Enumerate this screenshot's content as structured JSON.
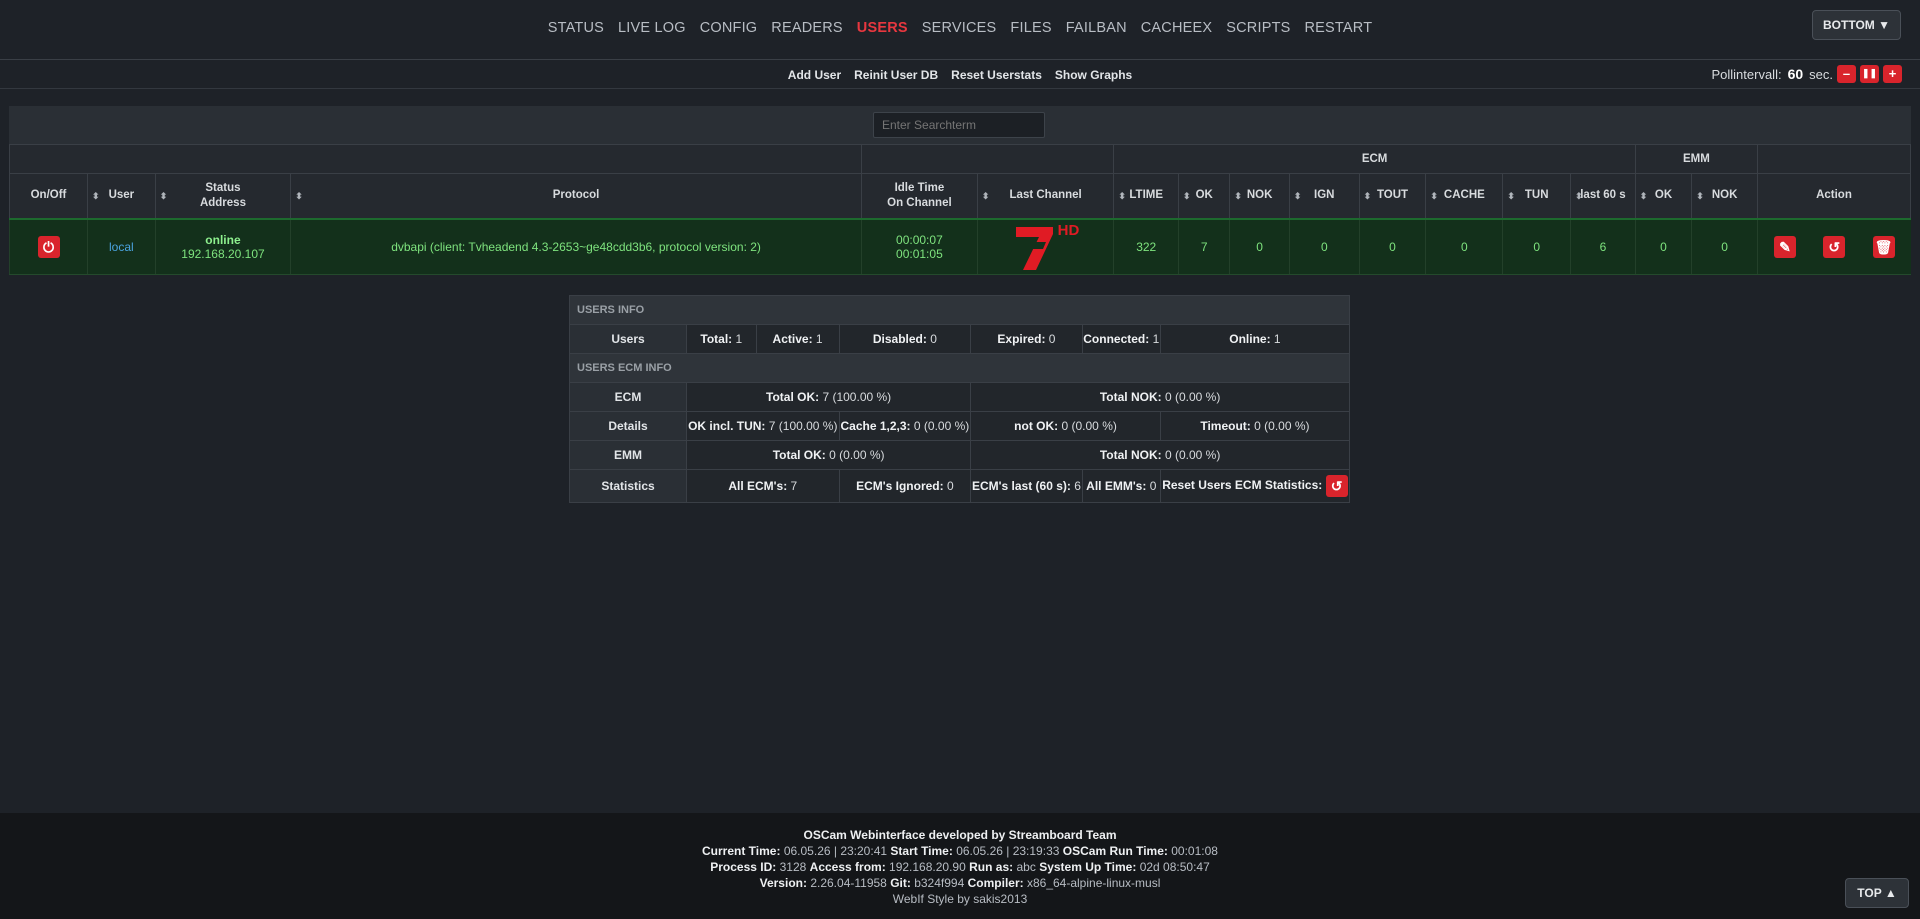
{
  "nav": {
    "items": [
      "STATUS",
      "LIVE LOG",
      "CONFIG",
      "READERS",
      "USERS",
      "SERVICES",
      "FILES",
      "FAILBAN",
      "CACHEEX",
      "SCRIPTS",
      "RESTART"
    ],
    "active": "USERS",
    "bottom_button": "BOTTOM ▼"
  },
  "subnav": {
    "items": [
      "Add User",
      "Reinit User DB",
      "Reset Userstats",
      "Show Graphs"
    ],
    "poll_label": "Pollintervall:",
    "poll_value": "60",
    "poll_unit": "sec.",
    "minus": "–",
    "pause": "❚❚",
    "plus": "+"
  },
  "search": {
    "placeholder": "Enter Searchterm"
  },
  "table": {
    "group_ecm": "ECM",
    "group_emm": "EMM",
    "headers": {
      "onoff": "On/Off",
      "user": "User",
      "status": "Status",
      "address": "Address",
      "protocol": "Protocol",
      "idle": "Idle Time",
      "onchannel": "On Channel",
      "lastchannel": "Last Channel",
      "ltime": "LTIME",
      "ok": "OK",
      "nok": "NOK",
      "ign": "IGN",
      "tout": "TOUT",
      "cache": "CACHE",
      "tun": "TUN",
      "last60": "last 60 s",
      "emm_ok": "OK",
      "emm_nok": "NOK",
      "action": "Action"
    },
    "row": {
      "user": "local",
      "status": "online",
      "address": "192.168.20.107",
      "protocol": "dvbapi (client: Tvheadend 4.3-2653~ge48cdd3b6, protocol version: 2)",
      "idle": "00:00:07",
      "onchannel": "00:01:05",
      "channel_logo_text": "HD",
      "ltime": "322",
      "ok": "7",
      "nok": "0",
      "ign": "0",
      "tout": "0",
      "cache": "0",
      "tun": "0",
      "last60": "6",
      "emm_ok": "0",
      "emm_nok": "0"
    }
  },
  "users_info": {
    "title": "USERS INFO",
    "users_label": "Users",
    "total_l": "Total:",
    "total_v": "1",
    "active_l": "Active:",
    "active_v": "1",
    "disabled_l": "Disabled:",
    "disabled_v": "0",
    "expired_l": "Expired:",
    "expired_v": "0",
    "connected_l": "Connected:",
    "connected_v": "1",
    "online_l": "Online:",
    "online_v": "1"
  },
  "ecm_info": {
    "title": "USERS ECM INFO",
    "ecm_label": "ECM",
    "ecm_ok_l": "Total OK:",
    "ecm_ok_v": "7 (100.00 %)",
    "ecm_nok_l": "Total NOK:",
    "ecm_nok_v": "0 (0.00 %)",
    "details_label": "Details",
    "okincl_l": "OK incl. TUN:",
    "okincl_v": "7 (100.00 %)",
    "cache_l": "Cache 1,2,3:",
    "cache_v": "0 (0.00 %)",
    "notok_l": "not OK:",
    "notok_v": "0 (0.00 %)",
    "timeout_l": "Timeout:",
    "timeout_v": "0 (0.00 %)",
    "emm_label": "EMM",
    "emm_ok_l": "Total OK:",
    "emm_ok_v": "0 (0.00 %)",
    "emm_nok_l": "Total NOK:",
    "emm_nok_v": "0 (0.00 %)",
    "stats_label": "Statistics",
    "allecm_l": "All ECM's:",
    "allecm_v": "7",
    "ignored_l": "ECM's Ignored:",
    "ignored_v": "0",
    "last60_l": "ECM's last (60 s):",
    "last60_v": "6",
    "allemm_l": "All EMM's:",
    "allemm_v": "0",
    "reset_l": "Reset Users ECM Statistics:"
  },
  "footer": {
    "line1": "OSCam Webinterface developed by Streamboard Team",
    "current_time_l": "Current Time:",
    "current_time_v": "06.05.26 | 23:20:41",
    "start_time_l": "Start Time:",
    "start_time_v": "06.05.26 | 23:19:33",
    "run_time_l": "OSCam Run Time:",
    "run_time_v": "00:01:08",
    "pid_l": "Process ID:",
    "pid_v": "3128",
    "access_l": "Access from:",
    "access_v": "192.168.20.90",
    "runas_l": "Run as:",
    "runas_v": "abc",
    "uptime_l": "System Up Time:",
    "uptime_v": "02d 08:50:47",
    "version_l": "Version:",
    "version_v": "2.26.04-11958",
    "git_l": "Git:",
    "git_v": "b324f994",
    "compiler_l": "Compiler:",
    "compiler_v": "x86_64-alpine-linux-musl",
    "style": "WebIf Style by sakis2013",
    "top_button": "TOP ▲"
  },
  "colors": {
    "accent": "#e8373f",
    "online_green": "#7ee37e",
    "row_bg": "#13301b",
    "link_blue": "#4aa3df"
  }
}
